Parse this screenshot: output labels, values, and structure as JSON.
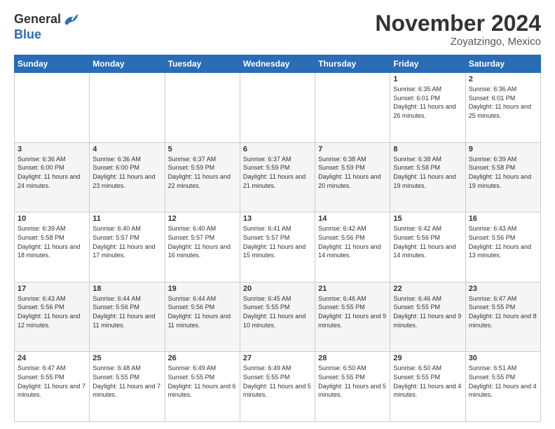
{
  "header": {
    "logo_general": "General",
    "logo_blue": "Blue",
    "month_title": "November 2024",
    "location": "Zoyatzingo, Mexico"
  },
  "days_of_week": [
    "Sunday",
    "Monday",
    "Tuesday",
    "Wednesday",
    "Thursday",
    "Friday",
    "Saturday"
  ],
  "weeks": [
    [
      {
        "day": "",
        "info": ""
      },
      {
        "day": "",
        "info": ""
      },
      {
        "day": "",
        "info": ""
      },
      {
        "day": "",
        "info": ""
      },
      {
        "day": "",
        "info": ""
      },
      {
        "day": "1",
        "info": "Sunrise: 6:35 AM\nSunset: 6:01 PM\nDaylight: 11 hours and 26 minutes."
      },
      {
        "day": "2",
        "info": "Sunrise: 6:36 AM\nSunset: 6:01 PM\nDaylight: 11 hours and 25 minutes."
      }
    ],
    [
      {
        "day": "3",
        "info": "Sunrise: 6:36 AM\nSunset: 6:00 PM\nDaylight: 11 hours and 24 minutes."
      },
      {
        "day": "4",
        "info": "Sunrise: 6:36 AM\nSunset: 6:00 PM\nDaylight: 11 hours and 23 minutes."
      },
      {
        "day": "5",
        "info": "Sunrise: 6:37 AM\nSunset: 5:59 PM\nDaylight: 11 hours and 22 minutes."
      },
      {
        "day": "6",
        "info": "Sunrise: 6:37 AM\nSunset: 5:59 PM\nDaylight: 11 hours and 21 minutes."
      },
      {
        "day": "7",
        "info": "Sunrise: 6:38 AM\nSunset: 5:59 PM\nDaylight: 11 hours and 20 minutes."
      },
      {
        "day": "8",
        "info": "Sunrise: 6:38 AM\nSunset: 5:58 PM\nDaylight: 11 hours and 19 minutes."
      },
      {
        "day": "9",
        "info": "Sunrise: 6:39 AM\nSunset: 5:58 PM\nDaylight: 11 hours and 19 minutes."
      }
    ],
    [
      {
        "day": "10",
        "info": "Sunrise: 6:39 AM\nSunset: 5:58 PM\nDaylight: 11 hours and 18 minutes."
      },
      {
        "day": "11",
        "info": "Sunrise: 6:40 AM\nSunset: 5:57 PM\nDaylight: 11 hours and 17 minutes."
      },
      {
        "day": "12",
        "info": "Sunrise: 6:40 AM\nSunset: 5:57 PM\nDaylight: 11 hours and 16 minutes."
      },
      {
        "day": "13",
        "info": "Sunrise: 6:41 AM\nSunset: 5:57 PM\nDaylight: 11 hours and 15 minutes."
      },
      {
        "day": "14",
        "info": "Sunrise: 6:42 AM\nSunset: 5:56 PM\nDaylight: 11 hours and 14 minutes."
      },
      {
        "day": "15",
        "info": "Sunrise: 6:42 AM\nSunset: 5:56 PM\nDaylight: 11 hours and 14 minutes."
      },
      {
        "day": "16",
        "info": "Sunrise: 6:43 AM\nSunset: 5:56 PM\nDaylight: 11 hours and 13 minutes."
      }
    ],
    [
      {
        "day": "17",
        "info": "Sunrise: 6:43 AM\nSunset: 5:56 PM\nDaylight: 11 hours and 12 minutes."
      },
      {
        "day": "18",
        "info": "Sunrise: 6:44 AM\nSunset: 5:56 PM\nDaylight: 11 hours and 11 minutes."
      },
      {
        "day": "19",
        "info": "Sunrise: 6:44 AM\nSunset: 5:56 PM\nDaylight: 11 hours and 11 minutes."
      },
      {
        "day": "20",
        "info": "Sunrise: 6:45 AM\nSunset: 5:55 PM\nDaylight: 11 hours and 10 minutes."
      },
      {
        "day": "21",
        "info": "Sunrise: 6:46 AM\nSunset: 5:55 PM\nDaylight: 11 hours and 9 minutes."
      },
      {
        "day": "22",
        "info": "Sunrise: 6:46 AM\nSunset: 5:55 PM\nDaylight: 11 hours and 9 minutes."
      },
      {
        "day": "23",
        "info": "Sunrise: 6:47 AM\nSunset: 5:55 PM\nDaylight: 11 hours and 8 minutes."
      }
    ],
    [
      {
        "day": "24",
        "info": "Sunrise: 6:47 AM\nSunset: 5:55 PM\nDaylight: 11 hours and 7 minutes."
      },
      {
        "day": "25",
        "info": "Sunrise: 6:48 AM\nSunset: 5:55 PM\nDaylight: 11 hours and 7 minutes."
      },
      {
        "day": "26",
        "info": "Sunrise: 6:49 AM\nSunset: 5:55 PM\nDaylight: 11 hours and 6 minutes."
      },
      {
        "day": "27",
        "info": "Sunrise: 6:49 AM\nSunset: 5:55 PM\nDaylight: 11 hours and 5 minutes."
      },
      {
        "day": "28",
        "info": "Sunrise: 6:50 AM\nSunset: 5:55 PM\nDaylight: 11 hours and 5 minutes."
      },
      {
        "day": "29",
        "info": "Sunrise: 6:50 AM\nSunset: 5:55 PM\nDaylight: 11 hours and 4 minutes."
      },
      {
        "day": "30",
        "info": "Sunrise: 6:51 AM\nSunset: 5:55 PM\nDaylight: 11 hours and 4 minutes."
      }
    ]
  ]
}
